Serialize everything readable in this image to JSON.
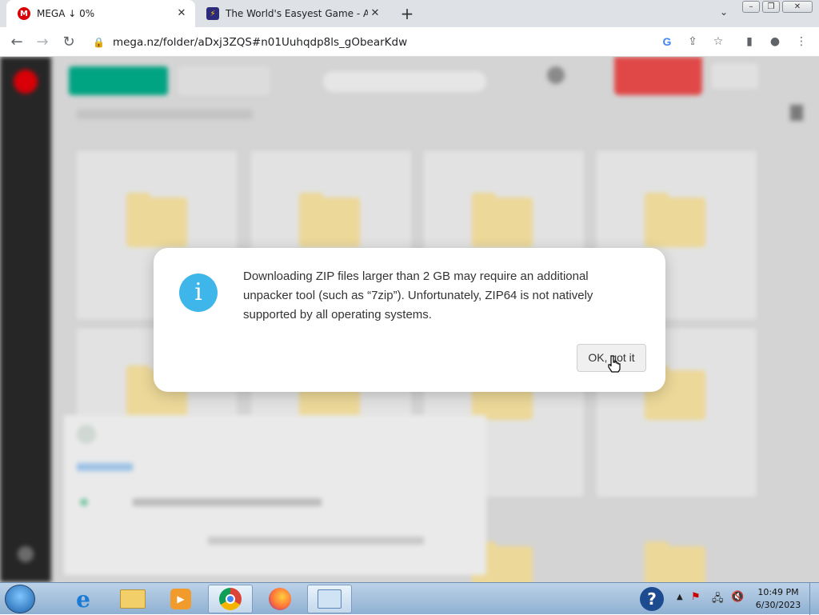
{
  "browser": {
    "tabs": [
      {
        "title": "MEGA ↓ 0%",
        "favicon": "mega-icon"
      },
      {
        "title": "The World's Easyest Game - Addi",
        "favicon": "bolt-icon"
      }
    ],
    "new_tab_label": "+",
    "url": "mega.nz/folder/aDxj3ZQS#n01Uuhqdp8ls_gObearKdw"
  },
  "dialog": {
    "message": "Downloading ZIP files larger than 2 GB may require an additional unpacker tool (such as “7zip”). Unfortunately, ZIP64 is not natively supported by all operating systems.",
    "ok_label": "OK, got it",
    "icon": "info-icon"
  },
  "taskbar": {
    "apps": [
      "ie-icon",
      "explorer-icon",
      "media-player-icon",
      "chrome-icon",
      "firefox-icon",
      "control-panel-icon"
    ],
    "time": "10:49 PM",
    "date": "6/30/2023"
  },
  "colors": {
    "mega_red": "#d90007",
    "info_blue": "#3fb6ea",
    "download_green": "#00a382"
  }
}
